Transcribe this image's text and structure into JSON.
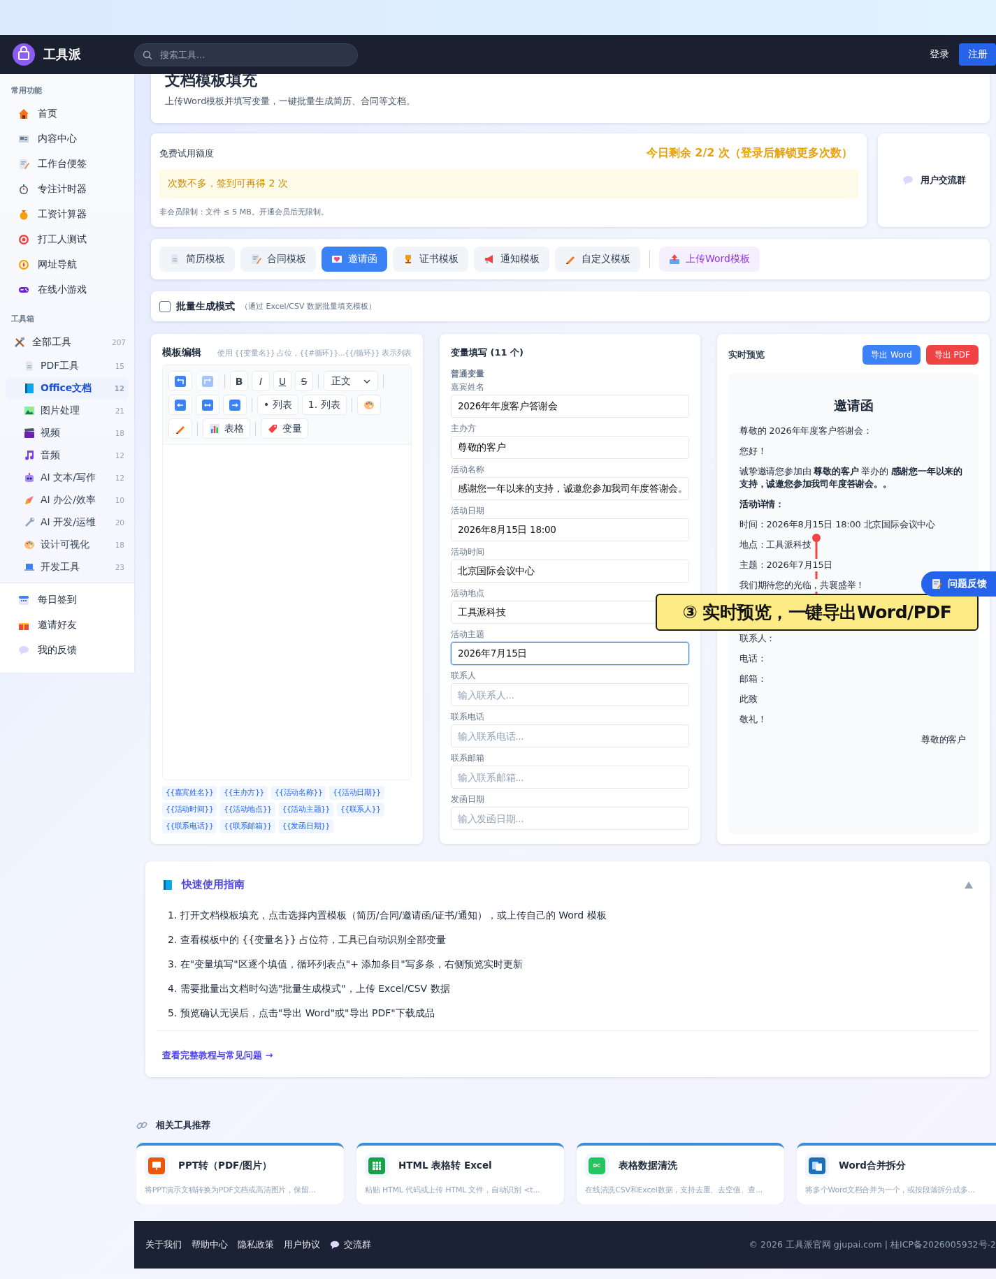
{
  "header": {
    "logo": "工具派",
    "search": {
      "placeholder": "搜索工具..."
    },
    "login": "登录",
    "register": "注册"
  },
  "sidebar": {
    "sections": [
      {
        "title": "常用功能",
        "items": [
          {
            "label": "首页",
            "selected": false
          },
          {
            "label": "内容中心",
            "selected": false
          },
          {
            "label": "工作台便签",
            "selected": false
          },
          {
            "label": "专注计时器",
            "selected": false
          },
          {
            "label": "工资计算器",
            "selected": false
          },
          {
            "label": "打工人测试",
            "selected": false
          },
          {
            "label": "网址导航",
            "selected": false
          },
          {
            "label": "在线小游戏",
            "selected": false
          }
        ]
      },
      {
        "title": "工具箱",
        "items": [
          {
            "label": "全部工具",
            "count": "207",
            "selected": false,
            "children": [
              {
                "label": "PDF工具",
                "count": "15",
                "selected": false
              },
              {
                "label": "Office文档",
                "count": "12",
                "selected": true
              },
              {
                "label": "图片处理",
                "count": "21",
                "selected": false
              },
              {
                "label": "视频",
                "count": "18",
                "selected": false
              },
              {
                "label": "音频",
                "count": "12",
                "selected": false
              },
              {
                "label": "AI 文本/写作",
                "count": "12",
                "selected": false
              },
              {
                "label": "AI 办公/效率",
                "count": "10",
                "selected": false
              },
              {
                "label": "AI 开发/运维",
                "count": "20",
                "selected": false
              },
              {
                "label": "设计可视化",
                "count": "18",
                "selected": false
              },
              {
                "label": "开发工具",
                "count": "23",
                "selected": false
              }
            ]
          }
        ]
      }
    ],
    "bottom_items": [
      {
        "label": "每日签到",
        "selected": false
      },
      {
        "label": "邀请好友",
        "selected": false
      },
      {
        "label": "我的反馈",
        "selected": false
      }
    ]
  },
  "page": {
    "title": "文档模板填充",
    "subtitle": "上传Word模板并填写变量，一键批量生成简历、合同等文档。"
  },
  "trial": {
    "label": "免费试用额度",
    "remaining": "今日剩余 2/2 次（登录后解锁更多次数）",
    "notice": "次数不多，签到可再得 2 次",
    "limit": "非会员限制：文件 ≤ 5 MB。开通会员后无限制。"
  },
  "community": {
    "label": "用户交流群"
  },
  "template_tabs": [
    {
      "label": "简历模板",
      "kind": "template",
      "selected": false
    },
    {
      "label": "合同模板",
      "kind": "template",
      "selected": false
    },
    {
      "label": "邀请函",
      "kind": "template",
      "selected": true
    },
    {
      "label": "证书模板",
      "kind": "template",
      "selected": false
    },
    {
      "label": "通知模板",
      "kind": "template",
      "selected": false
    },
    {
      "label": "自定义模板",
      "kind": "template",
      "selected": false
    },
    {
      "label": "上传Word模板",
      "kind": "upload",
      "selected": false
    }
  ],
  "batch": {
    "checked": false,
    "label": "批量生成模式",
    "hint": "（通过 Excel/CSV 数据批量填充模板）"
  },
  "editor": {
    "title": "模板编辑",
    "hint": "使用 {{变量名}} 占位，{{#循环}}...{{/循环}} 表示列表",
    "toolbar": [
      {
        "kind": "icon",
        "disabled": false
      },
      {
        "kind": "icon",
        "disabled": true
      },
      {
        "kind": "divider"
      },
      {
        "kind": "format",
        "label": "B",
        "disabled": false
      },
      {
        "kind": "format",
        "label": "I",
        "disabled": false
      },
      {
        "kind": "format",
        "label": "U",
        "disabled": false
      },
      {
        "kind": "format",
        "label": "S",
        "disabled": false
      },
      {
        "kind": "divider"
      },
      {
        "kind": "select",
        "label": "正文"
      },
      {
        "kind": "divider"
      },
      {
        "kind": "icon",
        "disabled": false
      },
      {
        "kind": "icon",
        "disabled": false
      },
      {
        "kind": "icon",
        "disabled": false
      },
      {
        "kind": "divider"
      },
      {
        "kind": "text",
        "label": "• 列表",
        "disabled": false
      },
      {
        "kind": "text",
        "label": "1. 列表",
        "disabled": false
      },
      {
        "kind": "divider"
      },
      {
        "kind": "icon",
        "disabled": false
      },
      {
        "kind": "icon",
        "disabled": false
      },
      {
        "kind": "divider"
      },
      {
        "kind": "icon_text",
        "label": "表格",
        "disabled": false
      },
      {
        "kind": "divider"
      },
      {
        "kind": "icon_text",
        "label": "变量",
        "disabled": false
      }
    ],
    "tokens": [
      "{{嘉宾姓名}}",
      "{{主办方}}",
      "{{活动名称}}",
      "{{活动日期}}",
      "{{活动时间}}",
      "{{活动地点}}",
      "{{活动主题}}",
      "{{联系人}}",
      "{{联系电话}}",
      "{{联系邮箱}}",
      "{{发函日期}}"
    ]
  },
  "variables": {
    "title": "变量填写 (11 个)",
    "group": "普通变量",
    "fields": [
      {
        "label": "嘉宾姓名",
        "value": "2026年年度客户答谢会",
        "focused": false
      },
      {
        "label": "主办方",
        "value": "尊敬的客户",
        "focused": false
      },
      {
        "label": "活动名称",
        "value": "感谢您一年以来的支持，诚邀您参加我司年度答谢会。",
        "focused": false
      },
      {
        "label": "活动日期",
        "value": "2026年8月15日 18:00",
        "focused": false
      },
      {
        "label": "活动时间",
        "value": "北京国际会议中心",
        "focused": false
      },
      {
        "label": "活动地点",
        "value": "工具派科技",
        "focused": false
      },
      {
        "label": "活动主题",
        "value": "2026年7月15日",
        "focused": true
      },
      {
        "label": "联系人",
        "placeholder": "输入联系人...",
        "focused": false
      },
      {
        "label": "联系电话",
        "placeholder": "输入联系电话...",
        "focused": false
      },
      {
        "label": "联系邮箱",
        "placeholder": "输入联系邮箱...",
        "focused": false
      },
      {
        "label": "发函日期",
        "placeholder": "输入发函日期...",
        "focused": false
      }
    ]
  },
  "preview": {
    "title": "实时预览",
    "buttons": [
      {
        "label": "导出 Word",
        "kind": "primary"
      },
      {
        "label": "导出 PDF",
        "kind": "danger"
      }
    ],
    "document": [
      {
        "kind": "heading",
        "text": "邀请函"
      },
      {
        "kind": "text",
        "text": "尊敬的 2026年年度客户答谢会："
      },
      {
        "kind": "text",
        "text": "您好！"
      },
      {
        "kind": "text",
        "text": "诚挚邀请您参加由 **尊敬的客户** 举办的 **感谢您一年以来的支持，诚邀您参加我司年度答谢会。。**"
      },
      {
        "kind": "subheading",
        "text": "活动详情："
      },
      {
        "kind": "text",
        "text": "时间：2026年8月15日 18:00 北京国际会议中心"
      },
      {
        "kind": "text",
        "text": "地点：工具派科技"
      },
      {
        "kind": "text",
        "text": "主题：2026年7月15日"
      },
      {
        "kind": "text",
        "text": "我们期待您的光临，共襄盛举！"
      },
      {
        "kind": "gap"
      },
      {
        "kind": "text",
        "text": "联系人："
      },
      {
        "kind": "text",
        "text": "电话："
      },
      {
        "kind": "text",
        "text": "邮箱："
      },
      {
        "kind": "text",
        "text": "此致"
      },
      {
        "kind": "text",
        "text": "敬礼！"
      },
      {
        "kind": "signature",
        "text": "尊敬的客户"
      }
    ]
  },
  "callout": {
    "text": "③ 实时预览，一键导出Word/PDF"
  },
  "feedback_button": {
    "label": "问题反馈"
  },
  "guide": {
    "title": "快速使用指南",
    "expanded": true,
    "steps": [
      "1. 打开文档模板填充，点击选择内置模板（简历/合同/邀请函/证书/通知），或上传自己的 Word 模板",
      "2. 查看模板中的 {{变量名}} 占位符，工具已自动识别全部变量",
      "3. 在\"变量填写\"区逐个填值，循环列表点\"+ 添加条目\"写多条，右侧预览实时更新",
      "4. 需要批量出文档时勾选\"批量生成模式\"，上传 Excel/CSV 数据",
      "5. 预览确认无误后，点击\"导出 Word\"或\"导出 PDF\"下载成品"
    ],
    "link": "查看完整教程与常见问题 →"
  },
  "related": {
    "title": "相关工具推荐",
    "cards": [
      {
        "name": "PPT转（PDF/图片）",
        "desc": "将PPT演示文稿转换为PDF文档或高清图片，保留..."
      },
      {
        "name": "HTML 表格转 Excel",
        "desc": "粘贴 HTML 代码或上传 HTML 文件，自动识别 <t..."
      },
      {
        "name": "表格数据清洗",
        "desc": "在线清洗CSV和Excel数据，支持去重、去空值、查...",
        "badge": "DC"
      },
      {
        "name": "Word合并拆分",
        "desc": "将多个Word文档合并为一个，或按段落拆分成多..."
      }
    ]
  },
  "footer": {
    "links": [
      {
        "label": "关于我们",
        "kind": "link"
      },
      {
        "label": "帮助中心",
        "kind": "link"
      },
      {
        "label": "隐私政策",
        "kind": "link"
      },
      {
        "label": "用户协议",
        "kind": "link"
      },
      {
        "label": "交流群",
        "kind": "chat"
      }
    ],
    "copyright": "© 2026 工具派官网 gjupai.com | 桂ICP备2026005932号-2"
  }
}
